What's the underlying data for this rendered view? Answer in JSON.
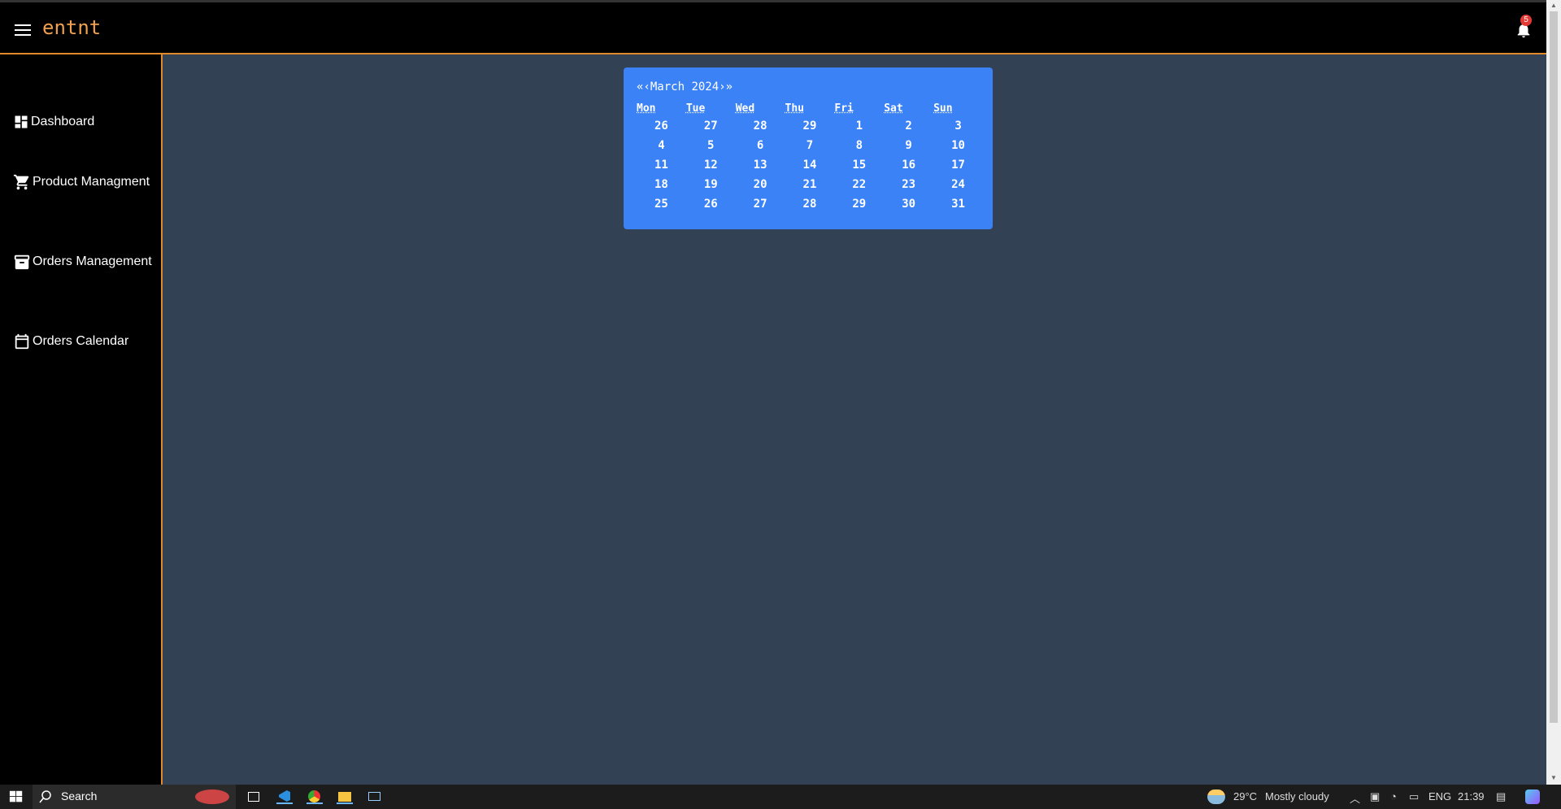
{
  "app": {
    "logo": "entnt",
    "notification_count": "5"
  },
  "sidebar": {
    "items": [
      {
        "label": "Dashboard",
        "icon": "dashboard-icon"
      },
      {
        "label": "Product Managment",
        "icon": "cart-icon"
      },
      {
        "label": "Orders Management",
        "icon": "archive-icon"
      },
      {
        "label": "Orders Calendar",
        "icon": "calendar-icon"
      }
    ]
  },
  "calendar": {
    "prev_year": "«",
    "prev_month": "‹",
    "month_label": "March 2024",
    "next_month": "›",
    "next_year": "»",
    "weekdays": [
      "Mon",
      "Tue",
      "Wed",
      "Thu",
      "Fri",
      "Sat",
      "Sun"
    ],
    "weeks": [
      [
        "26",
        "27",
        "28",
        "29",
        "1",
        "2",
        "3"
      ],
      [
        "4",
        "5",
        "6",
        "7",
        "8",
        "9",
        "10"
      ],
      [
        "11",
        "12",
        "13",
        "14",
        "15",
        "16",
        "17"
      ],
      [
        "18",
        "19",
        "20",
        "21",
        "22",
        "23",
        "24"
      ],
      [
        "25",
        "26",
        "27",
        "28",
        "29",
        "30",
        "31"
      ]
    ]
  },
  "taskbar": {
    "search_label": "Search",
    "weather": "29°C",
    "weather_desc": "Mostly cloudy",
    "language": "ENG",
    "time": "21:39"
  }
}
